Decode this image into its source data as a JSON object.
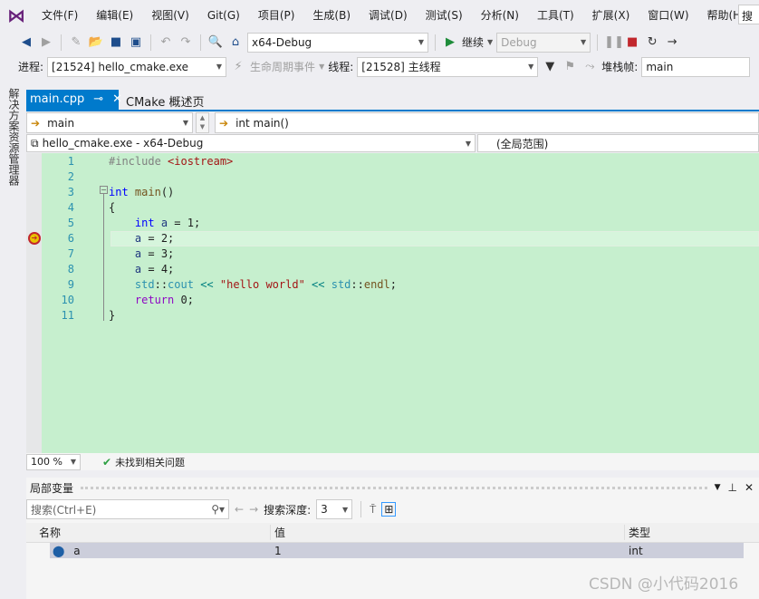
{
  "menu": [
    "文件(F)",
    "编辑(E)",
    "视图(V)",
    "Git(G)",
    "项目(P)",
    "生成(B)",
    "调试(D)",
    "测试(S)",
    "分析(N)",
    "工具(T)",
    "扩展(X)",
    "窗口(W)",
    "帮助(H)"
  ],
  "search_placeholder": "搜",
  "toolbar": {
    "config": "x64-Debug",
    "continue": "继续",
    "platform": "Debug"
  },
  "debug_bar": {
    "process_label": "进程:",
    "process": "[21524] hello_cmake.exe",
    "lifecycle": "生命周期事件",
    "thread_label": "线程:",
    "thread": "[21528] 主线程",
    "stack_label": "堆栈帧:",
    "stack": "main"
  },
  "sidebar": {
    "label": "解决方案资源管理器"
  },
  "tabs": [
    {
      "label": "main.cpp",
      "active": true
    },
    {
      "label": "CMake 概述页"
    }
  ],
  "nav": {
    "scope": "main",
    "member": "int main()",
    "project": "hello_cmake.exe - x64-Debug",
    "global": "(全局范围)"
  },
  "code": {
    "line_numbers": [
      "1",
      "2",
      "3",
      "4",
      "5",
      "6",
      "7",
      "8",
      "9",
      "10",
      "11"
    ],
    "current_line": 6
  },
  "status": {
    "zoom": "100 %",
    "issues": "未找到相关问题"
  },
  "locals": {
    "title": "局部变量",
    "search_placeholder": "搜索(Ctrl+E)",
    "depth_label": "搜索深度:",
    "depth": "3",
    "columns": [
      "名称",
      "值",
      "类型"
    ],
    "rows": [
      {
        "name": "a",
        "value": "1",
        "type": "int"
      }
    ]
  },
  "watermark": "CSDN @小代码2016"
}
